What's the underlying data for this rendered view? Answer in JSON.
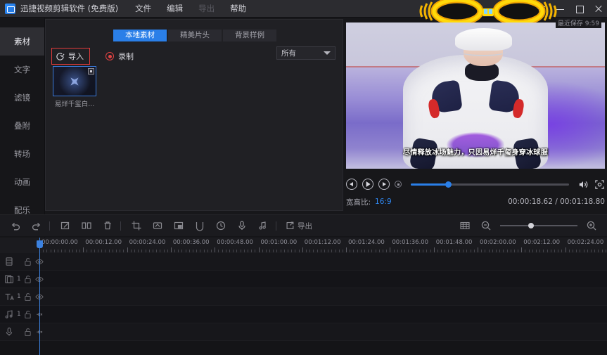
{
  "titlebar": {
    "app_title": "迅捷视频剪辑软件 (免费版)",
    "logo_icon": "app-logo-icon",
    "menus": [
      {
        "label": "文件",
        "disabled": false
      },
      {
        "label": "编辑",
        "disabled": false
      },
      {
        "label": "导出",
        "disabled": true
      },
      {
        "label": "帮助",
        "disabled": false
      }
    ],
    "window_controls": [
      {
        "name": "menu-icon"
      },
      {
        "name": "minimize-icon"
      },
      {
        "name": "maximize-icon"
      },
      {
        "name": "close-icon"
      }
    ],
    "saved_note": "最近保存 9:59"
  },
  "sidebar": {
    "items": [
      {
        "label": "素材",
        "active": true
      },
      {
        "label": "文字",
        "active": false
      },
      {
        "label": "滤镜",
        "active": false
      },
      {
        "label": "叠附",
        "active": false
      },
      {
        "label": "转场",
        "active": false
      },
      {
        "label": "动画",
        "active": false
      },
      {
        "label": "配乐",
        "active": false
      }
    ]
  },
  "media_panel": {
    "tabs": [
      {
        "label": "本地素材",
        "active": true
      },
      {
        "label": "精美片头",
        "active": false
      },
      {
        "label": "背景样例",
        "active": false
      }
    ],
    "import_button": {
      "label": "导入",
      "icon": "import-icon",
      "highlight_color": "#e23b3b"
    },
    "record_button": {
      "label": "录制",
      "icon": "record-icon"
    },
    "filter_select": {
      "value": "所有",
      "icon": "chevron-down-icon"
    },
    "items": [
      {
        "caption": "易烊千玺白...",
        "selected": true,
        "badge_icon": "more-icon"
      }
    ]
  },
  "preview": {
    "subtitle_text": "尽情释放冰场魅力，只因易烊千玺身穿冰球服",
    "controls": {
      "prev_frame": "prev-frame-icon",
      "play": "play-icon",
      "next_frame": "next-frame-icon",
      "stop": "stop-icon",
      "volume": "volume-icon",
      "fullscreen": "fullscreen-icon",
      "progress_percent": 23.6
    },
    "ratio_label": "宽高比:",
    "ratio_value": "16:9",
    "time_code": "00:00:18.62 / 00:01:18.80",
    "accent_color": "#2a7fe8"
  },
  "toolbar": {
    "icons": [
      {
        "name": "undo-icon"
      },
      {
        "name": "redo-icon"
      },
      {
        "name": "edit-icon"
      },
      {
        "name": "split-icon"
      },
      {
        "name": "delete-icon"
      },
      {
        "name": "crop-icon"
      },
      {
        "name": "rotate-icon"
      },
      {
        "name": "picture-in-picture-icon"
      },
      {
        "name": "mask-icon"
      },
      {
        "name": "speed-icon"
      },
      {
        "name": "microphone-icon"
      },
      {
        "name": "audio-detach-icon"
      }
    ],
    "export_button": {
      "label": "导出",
      "icon": "export-icon"
    },
    "zoom": {
      "fit_icon": "fit-timeline-icon",
      "zoom_out_icon": "zoom-out-icon",
      "zoom_in_icon": "zoom-in-icon",
      "level_percent": 40
    }
  },
  "timeline": {
    "ruler_labels": [
      "00:00:00.00",
      "00:00:12.00",
      "00:00:24.00",
      "00:00:36.00",
      "00:00:48.00",
      "00:01:00.00",
      "00:01:12.00",
      "00:01:24.00",
      "00:01:36.00",
      "00:01:48.00",
      "00:02:00.00",
      "00:02:12.00",
      "00:02:24.00"
    ],
    "tracks": [
      {
        "icon": "video-track-icon",
        "count": "",
        "lock_icon": "unlock-icon",
        "eye_icon": "eye-icon"
      },
      {
        "icon": "overlay-track-icon",
        "count": "1",
        "lock_icon": "unlock-icon",
        "eye_icon": "eye-icon"
      },
      {
        "icon": "text-track-icon",
        "count": "1",
        "lock_icon": "unlock-icon",
        "eye_icon": "eye-icon"
      },
      {
        "icon": "music-track-icon",
        "count": "1",
        "lock_icon": "unlock-icon",
        "eye_icon": "mute-icon"
      },
      {
        "icon": "voiceover-track-icon",
        "count": "",
        "lock_icon": "unlock-icon",
        "eye_icon": "mute-icon"
      }
    ],
    "playhead_position": "00:00:00.00"
  }
}
